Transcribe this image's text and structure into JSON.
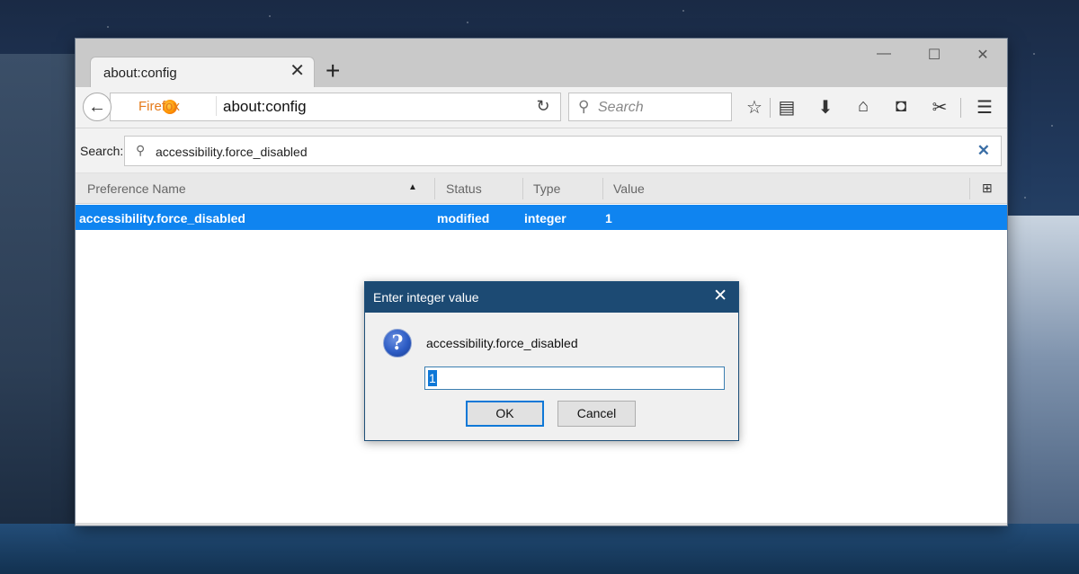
{
  "browser": {
    "tab_title": "about:config",
    "new_tab_symbol": "+",
    "window_controls": [
      "—",
      "☐",
      "✕"
    ],
    "identity_label": "Firefox",
    "url": "about:config",
    "search_placeholder": "Search"
  },
  "config": {
    "search_label": "Search:",
    "search_value": "accessibility.force_disabled",
    "columns": [
      "Preference Name",
      "Status",
      "Type",
      "Value"
    ],
    "rows": [
      {
        "name": "accessibility.force_disabled",
        "status": "modified",
        "type": "integer",
        "value": "1"
      }
    ]
  },
  "dialog": {
    "title": "Enter integer value",
    "message": "accessibility.force_disabled",
    "input_value": "1",
    "ok_label": "OK",
    "cancel_label": "Cancel"
  },
  "colors": {
    "selected_row": "#0f84f0",
    "dialog_titlebar": "#1c4a73",
    "firefox_label": "#e57a1a"
  },
  "icons": [
    "back-arrow-icon",
    "firefox-logo-icon",
    "reload-icon",
    "search-icon",
    "bookmark-star-icon",
    "reading-list-icon",
    "download-icon",
    "home-icon",
    "pocket-icon",
    "extension-icon",
    "menu-icon",
    "question-icon",
    "column-picker-icon",
    "close-icon"
  ]
}
